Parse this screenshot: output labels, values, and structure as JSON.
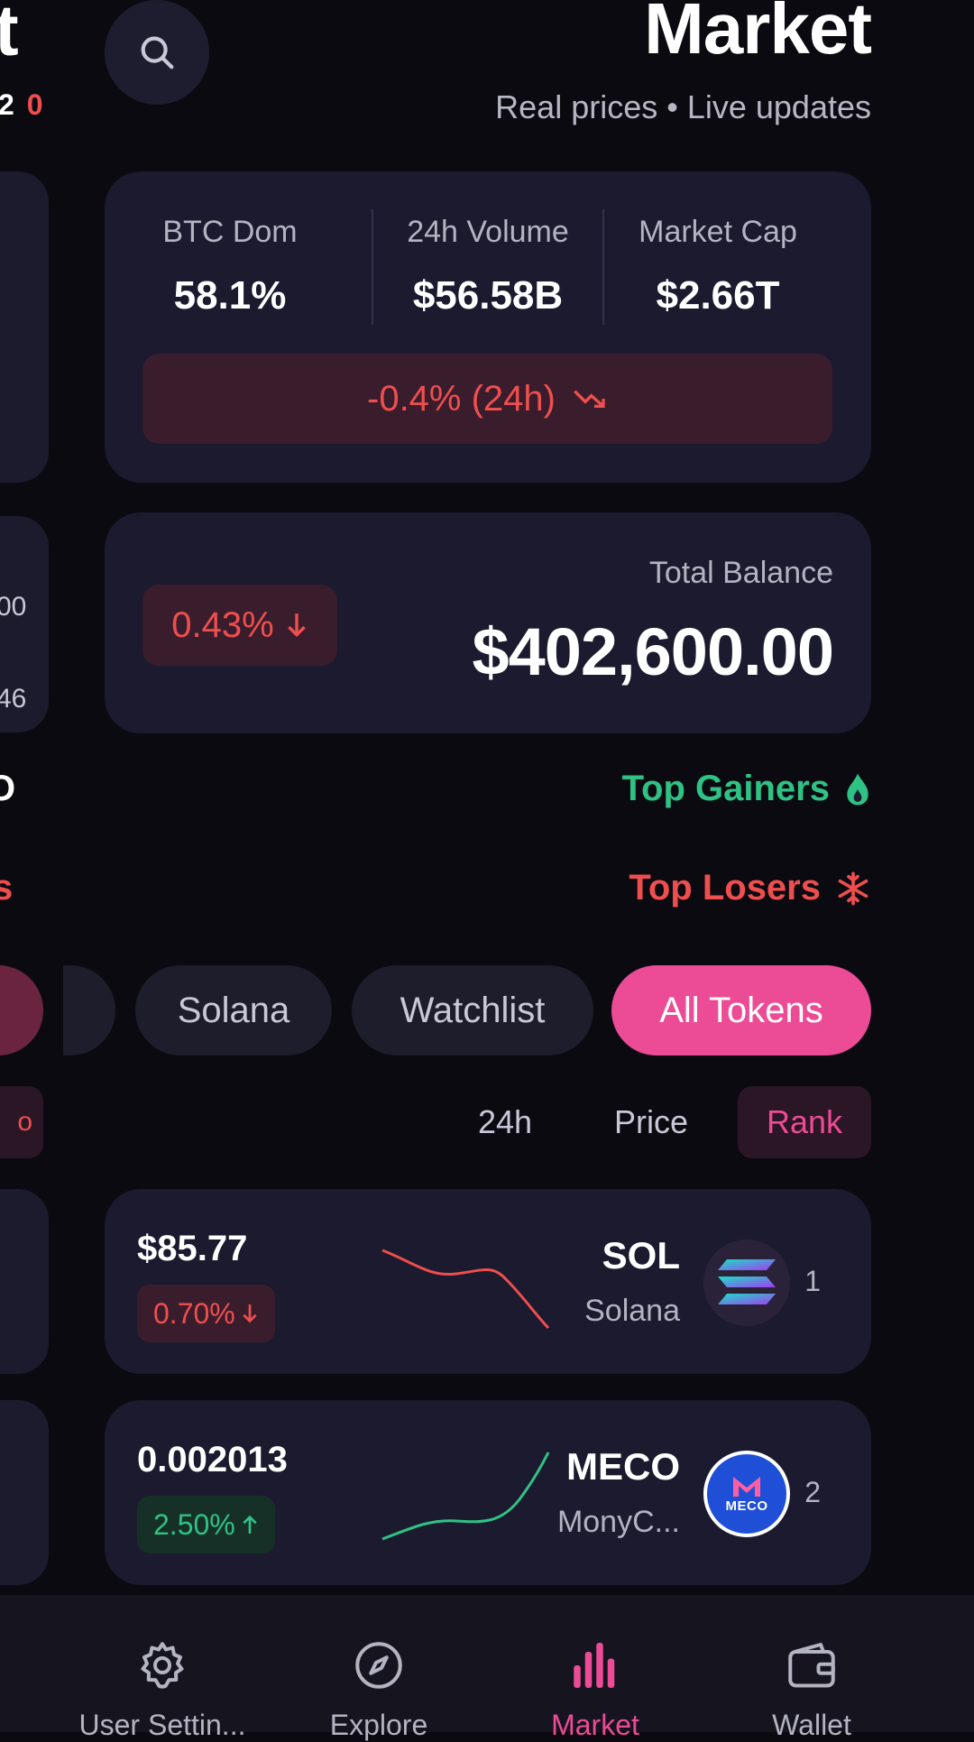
{
  "peek": {
    "title_fragment": "t",
    "badge_fragment": "2",
    "badge_zero": "0",
    "row1_fragment": "00",
    "row2_fragment": "46",
    "row3_fragment": "O",
    "row4_fragment": "s",
    "row5_fragment": "o"
  },
  "header": {
    "title": "Market",
    "subtitle": "Real prices • Live updates"
  },
  "stats": [
    {
      "label": "BTC Dom",
      "value": "58.1%"
    },
    {
      "label": "24h Volume",
      "value": "$56.58B"
    },
    {
      "label": "Market Cap",
      "value": "$2.66T"
    }
  ],
  "market_change": "-0.4% (24h)",
  "balance": {
    "label": "Total Balance",
    "value": "$402,600.00",
    "change": "0.43%",
    "change_direction": "down"
  },
  "sections": {
    "gainers": "Top Gainers",
    "losers": "Top Losers"
  },
  "filters": [
    {
      "label": "Solana",
      "active": false
    },
    {
      "label": "Watchlist",
      "active": false
    },
    {
      "label": "All Tokens",
      "active": true
    }
  ],
  "sort_options": [
    {
      "label": "24h",
      "active": false
    },
    {
      "label": "Price",
      "active": false
    },
    {
      "label": "Rank",
      "active": true
    }
  ],
  "tokens": [
    {
      "price": "$85.77",
      "change": "0.70%",
      "direction": "down",
      "symbol": "SOL",
      "name": "Solana",
      "rank": "1",
      "logo_text": ""
    },
    {
      "price": "0.002013",
      "change": "2.50%",
      "direction": "up",
      "symbol": "MECO",
      "name": "MonyC...",
      "rank": "2",
      "logo_text": "MECO"
    }
  ],
  "nav": [
    {
      "label": "User Settin...",
      "icon": "gear-icon",
      "active": false
    },
    {
      "label": "Explore",
      "icon": "compass-icon",
      "active": false
    },
    {
      "label": "Market",
      "icon": "bar-chart-icon",
      "active": true
    },
    {
      "label": "Wallet",
      "icon": "wallet-icon",
      "active": false
    }
  ],
  "colors": {
    "background": "#0b0a10",
    "card": "#1b1a2e",
    "accent": "#ec4b96",
    "negative": "#ef4e4e",
    "positive": "#2fc285"
  }
}
